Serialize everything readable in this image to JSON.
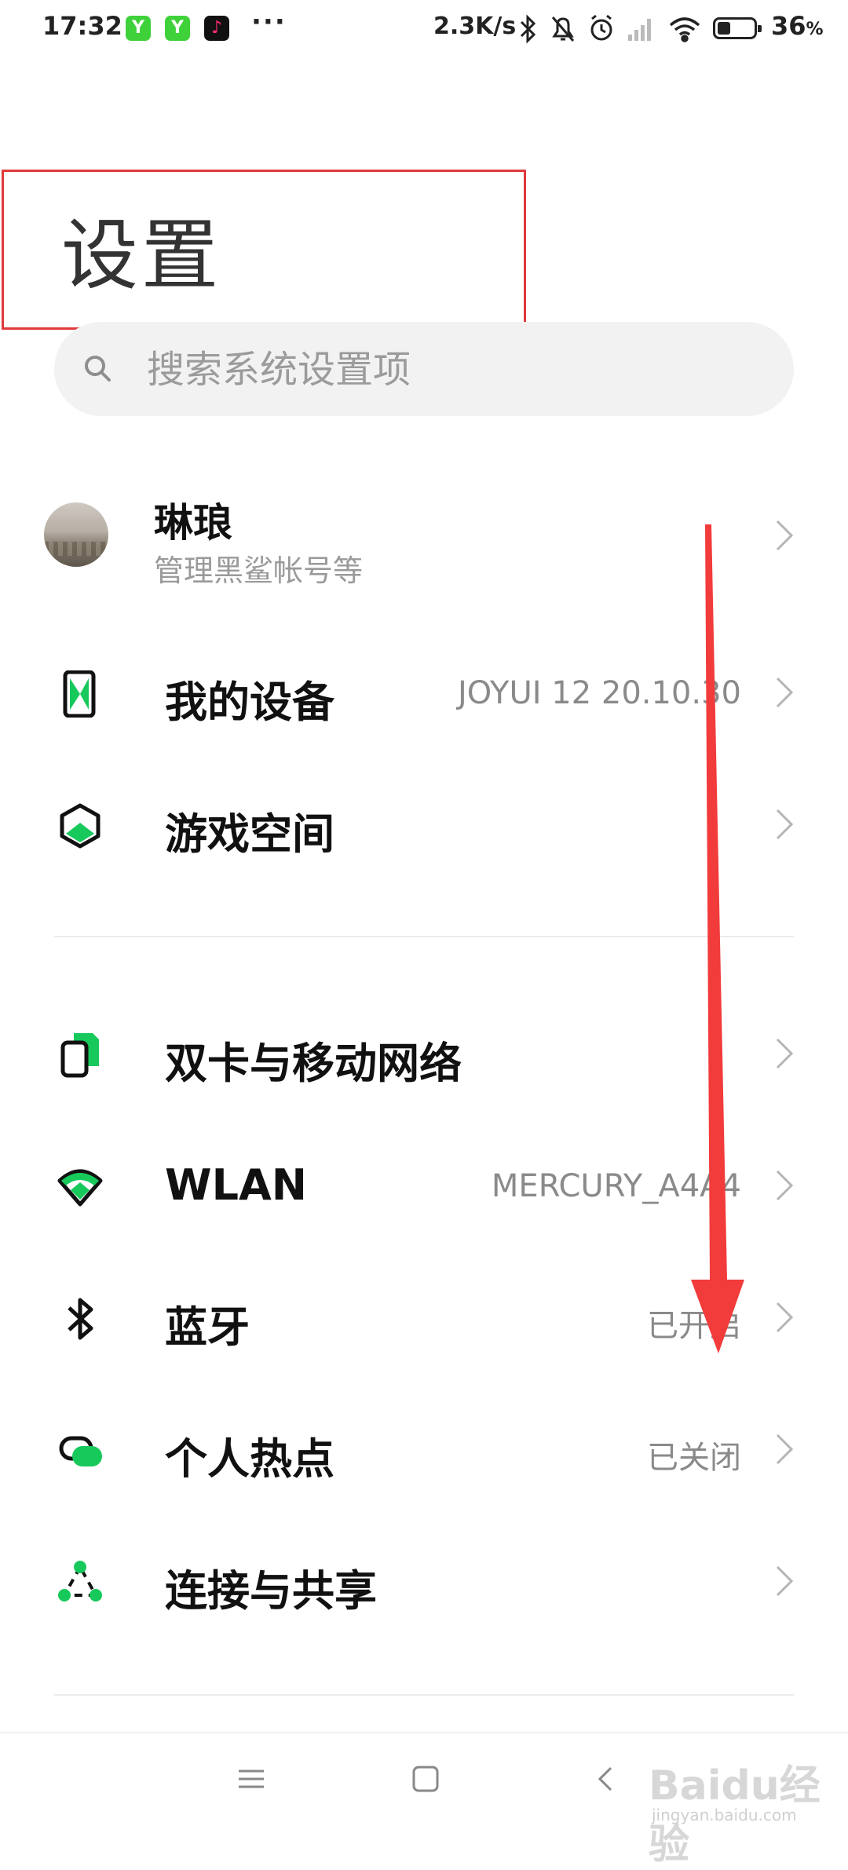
{
  "status_bar": {
    "time": "17:32",
    "apps": [
      "Y",
      "Y",
      "♪"
    ],
    "more": "···",
    "net_speed": "2.3K/s",
    "battery_level": 0.36,
    "battery_pct": "36",
    "battery_unit": "%"
  },
  "page": {
    "title": "设置"
  },
  "search": {
    "placeholder": "搜索系统设置项"
  },
  "account": {
    "name": "琳琅",
    "subtitle": "管理黑鲨帐号等"
  },
  "items": [
    {
      "id": "my-device",
      "label": "我的设备",
      "value": "JOYUI 12 20.10.30",
      "icon": "phone-device-icon"
    },
    {
      "id": "game-space",
      "label": "游戏空间",
      "value": "",
      "icon": "game-hexagon-icon"
    },
    {
      "id": "sim-network",
      "label": "双卡与移动网络",
      "value": "",
      "icon": "dual-sim-icon"
    },
    {
      "id": "wlan",
      "label": "WLAN",
      "value": "MERCURY_A4A4",
      "icon": "wifi-icon"
    },
    {
      "id": "bluetooth",
      "label": "蓝牙",
      "value": "已开启",
      "icon": "bluetooth-icon"
    },
    {
      "id": "hotspot",
      "label": "个人热点",
      "value": "已关闭",
      "icon": "hotspot-icon"
    },
    {
      "id": "connect-share",
      "label": "连接与共享",
      "value": "",
      "icon": "share-nodes-icon"
    }
  ],
  "colors": {
    "accent_green": "#17c95b",
    "highlight_red": "#e03a3a",
    "arrow_red": "#f23b3b"
  },
  "watermark": {
    "text": "Baidu经验",
    "url": "jingyan.baidu.com"
  }
}
